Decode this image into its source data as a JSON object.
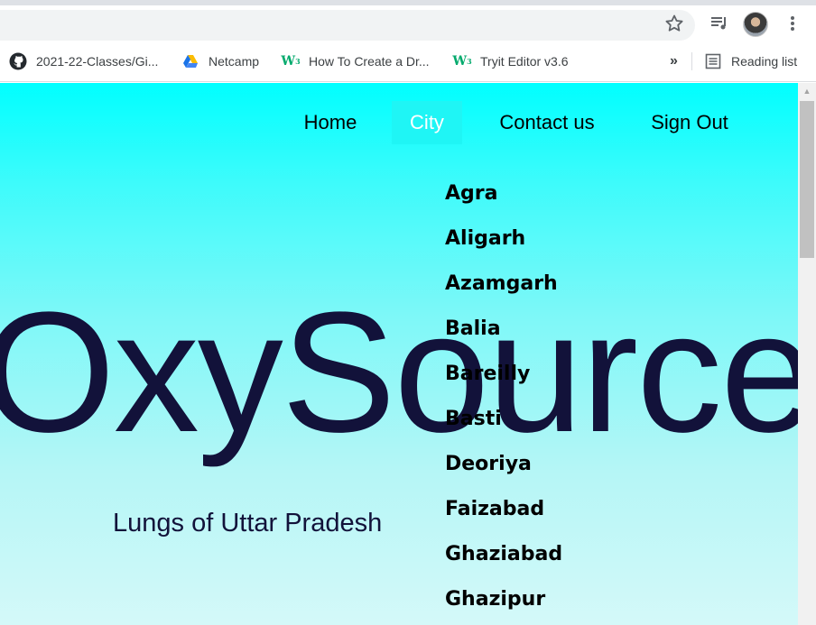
{
  "browser": {
    "bookmarks": [
      {
        "label": "2021-22-Classes/Gi...",
        "icon": "github-icon"
      },
      {
        "label": "Netcamp",
        "icon": "google-drive-icon"
      },
      {
        "label": "How To Create a Dr...",
        "icon": "w3schools-icon"
      },
      {
        "label": "Tryit Editor v3.6",
        "icon": "w3schools-icon"
      }
    ],
    "more_bookmarks": "»",
    "reading_list": "Reading list"
  },
  "nav": {
    "home": "Home",
    "city": "City",
    "contact": "Contact us",
    "signout": "Sign Out"
  },
  "hero": {
    "title": "OxySource",
    "subtitle": "Lungs of Uttar Pradesh"
  },
  "cities": [
    "Agra",
    "Aligarh",
    "Azamgarh",
    "Balia",
    "Bareilly",
    "Basti",
    "Deoriya",
    "Faizabad",
    "Ghaziabad",
    "Ghazipur"
  ],
  "colors": {
    "page_top": "#00ffff",
    "page_bottom": "#d4f9f9",
    "active_nav_bg": "#1ff5f5",
    "title": "#12123a"
  }
}
